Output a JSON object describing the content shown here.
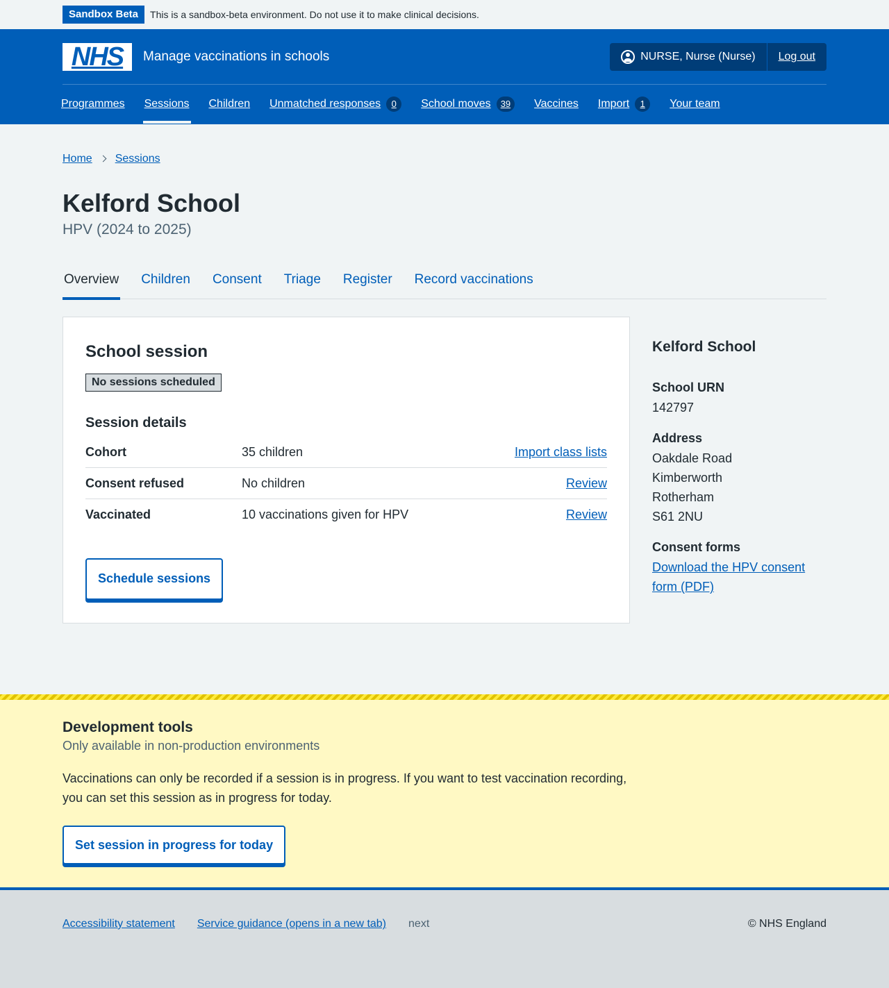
{
  "beta": {
    "tag": "Sandbox Beta",
    "text": "This is a sandbox-beta environment. Do not use it to make clinical decisions."
  },
  "header": {
    "logo": "NHS",
    "service_name": "Manage vaccinations in schools",
    "user": "NURSE, Nurse (Nurse)",
    "logout": "Log out",
    "nav": [
      {
        "label": "Programmes"
      },
      {
        "label": "Sessions"
      },
      {
        "label": "Children"
      },
      {
        "label": "Unmatched responses",
        "count": "0"
      },
      {
        "label": "School moves",
        "count": "39"
      },
      {
        "label": "Vaccines"
      },
      {
        "label": "Import",
        "count": "1"
      },
      {
        "label": "Your team"
      }
    ]
  },
  "breadcrumb": [
    "Home",
    "Sessions"
  ],
  "page": {
    "title": "Kelford School",
    "caption": "HPV (2024 to 2025)"
  },
  "tabs": [
    "Overview",
    "Children",
    "Consent",
    "Triage",
    "Register",
    "Record vaccinations"
  ],
  "session": {
    "heading": "School session",
    "status": "No sessions scheduled",
    "details_heading": "Session details",
    "rows": [
      {
        "key": "Cohort",
        "value": "35 children",
        "action": "Import class lists"
      },
      {
        "key": "Consent refused",
        "value": "No children",
        "action": "Review"
      },
      {
        "key": "Vaccinated",
        "value": "10 vaccinations given for HPV",
        "action": "Review"
      }
    ],
    "button": "Schedule sessions"
  },
  "aside": {
    "school": "Kelford School",
    "urn_label": "School URN",
    "urn": "142797",
    "address_label": "Address",
    "address": [
      "Oakdale Road",
      "Kimberworth",
      "Rotherham",
      "S61 2NU"
    ],
    "consent_label": "Consent forms",
    "consent_link_1": "Download the HPV consent",
    "consent_link_2": "form (PDF)"
  },
  "dev": {
    "heading": "Development tools",
    "sub": "Only available in non-production environments",
    "text": "Vaccinations can only be recorded if a session is in progress. If you want to test vaccination recording, you can set this session as in progress for today.",
    "button": "Set session in progress for today"
  },
  "footer": {
    "accessibility": "Accessibility statement",
    "guidance": "Service guidance (opens in a new tab)",
    "version": "next",
    "copyright": "© NHS England"
  }
}
